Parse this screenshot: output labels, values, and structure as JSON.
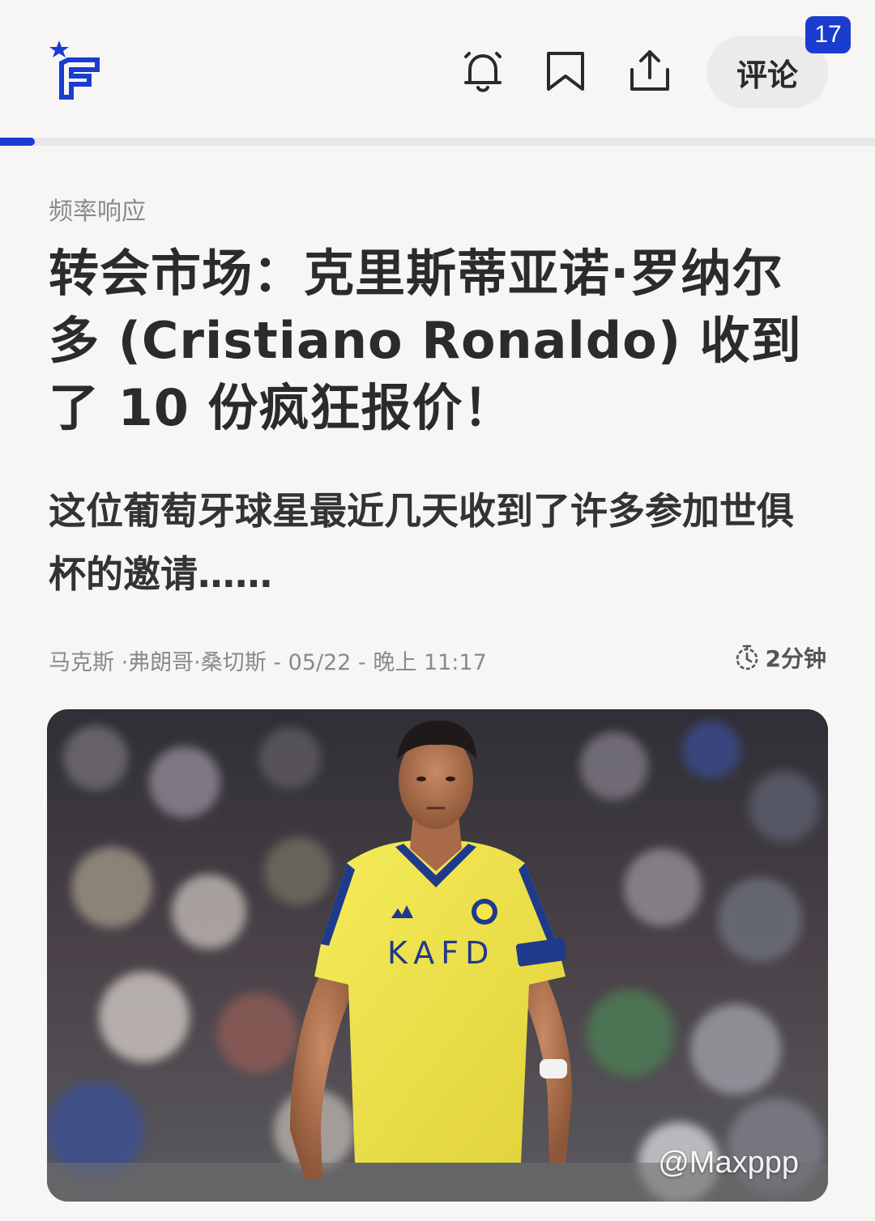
{
  "header": {
    "logo_icon": "brand-logo-icon",
    "comments_label": "评论",
    "comments_count": "17",
    "icons": [
      "bell-icon",
      "bookmark-icon",
      "share-icon"
    ]
  },
  "reading_progress": 0.04,
  "article": {
    "category": "频率响应",
    "title": "转会市场：克里斯蒂亚诺·罗纳尔多 (Cristiano Ronaldo) 收到了 10 份疯狂报价！",
    "subtitle": "这位葡萄牙球星最近几天收到了许多参加世俱杯的邀请……",
    "meta": "马克斯 ·弗朗哥·桑切斯 - 05/22 - 晚上 11:17",
    "read_time": "2分钟",
    "image_credit": "@Maxppp",
    "jersey_text": "KAFD"
  },
  "colors": {
    "accent": "#1a3ccf",
    "background": "#f7f6f4",
    "jersey_yellow": "#f2e64a",
    "jersey_blue": "#1f3a8a"
  }
}
